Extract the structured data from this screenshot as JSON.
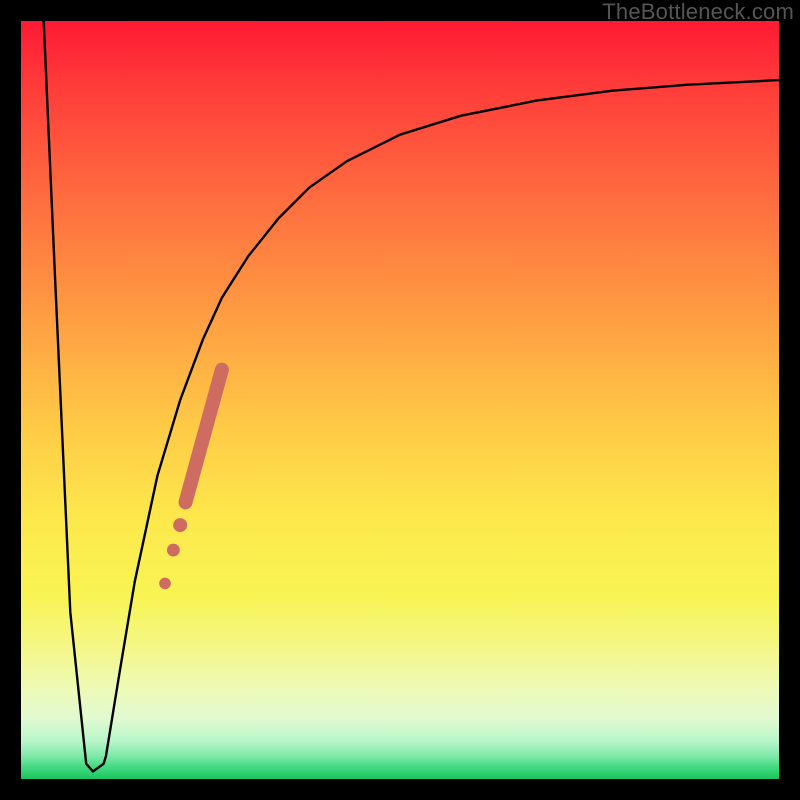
{
  "watermark": "TheBottleneck.com",
  "colors": {
    "highlight": "#cf6c62",
    "curve": "#000000"
  },
  "chart_data": {
    "type": "line",
    "title": "",
    "xlabel": "",
    "ylabel": "",
    "xlim": [
      0,
      100
    ],
    "ylim": [
      0,
      100
    ],
    "grid": false,
    "curve_x": [
      3.0,
      4.5,
      6.5,
      8.6,
      9.5,
      10.9,
      11.2,
      13.0,
      15.0,
      18.0,
      21.0,
      24.0,
      26.5,
      30.0,
      34.0,
      38.0,
      43.0,
      50.0,
      58.0,
      68.0,
      78.0,
      88.0,
      100.0
    ],
    "curve_y": [
      100.0,
      66.0,
      22.0,
      2.0,
      1.0,
      2.0,
      3.0,
      14.0,
      26.0,
      40.0,
      50.0,
      58.0,
      63.5,
      69.0,
      74.0,
      78.0,
      81.5,
      85.0,
      87.5,
      89.5,
      90.8,
      91.6,
      92.2
    ],
    "highlight_segment": {
      "x1": 21.7,
      "y1": 36.5,
      "x2": 26.5,
      "y2": 54.0
    },
    "highlight_points": [
      {
        "x": 21.0,
        "y": 33.5
      },
      {
        "x": 20.1,
        "y": 30.2
      },
      {
        "x": 19.0,
        "y": 25.8
      }
    ],
    "gradient_stops": [
      {
        "pos": 0,
        "color": "#ff1a33"
      },
      {
        "pos": 0.66,
        "color": "#fde94c"
      },
      {
        "pos": 1.0,
        "color": "#1bc45e"
      }
    ]
  }
}
